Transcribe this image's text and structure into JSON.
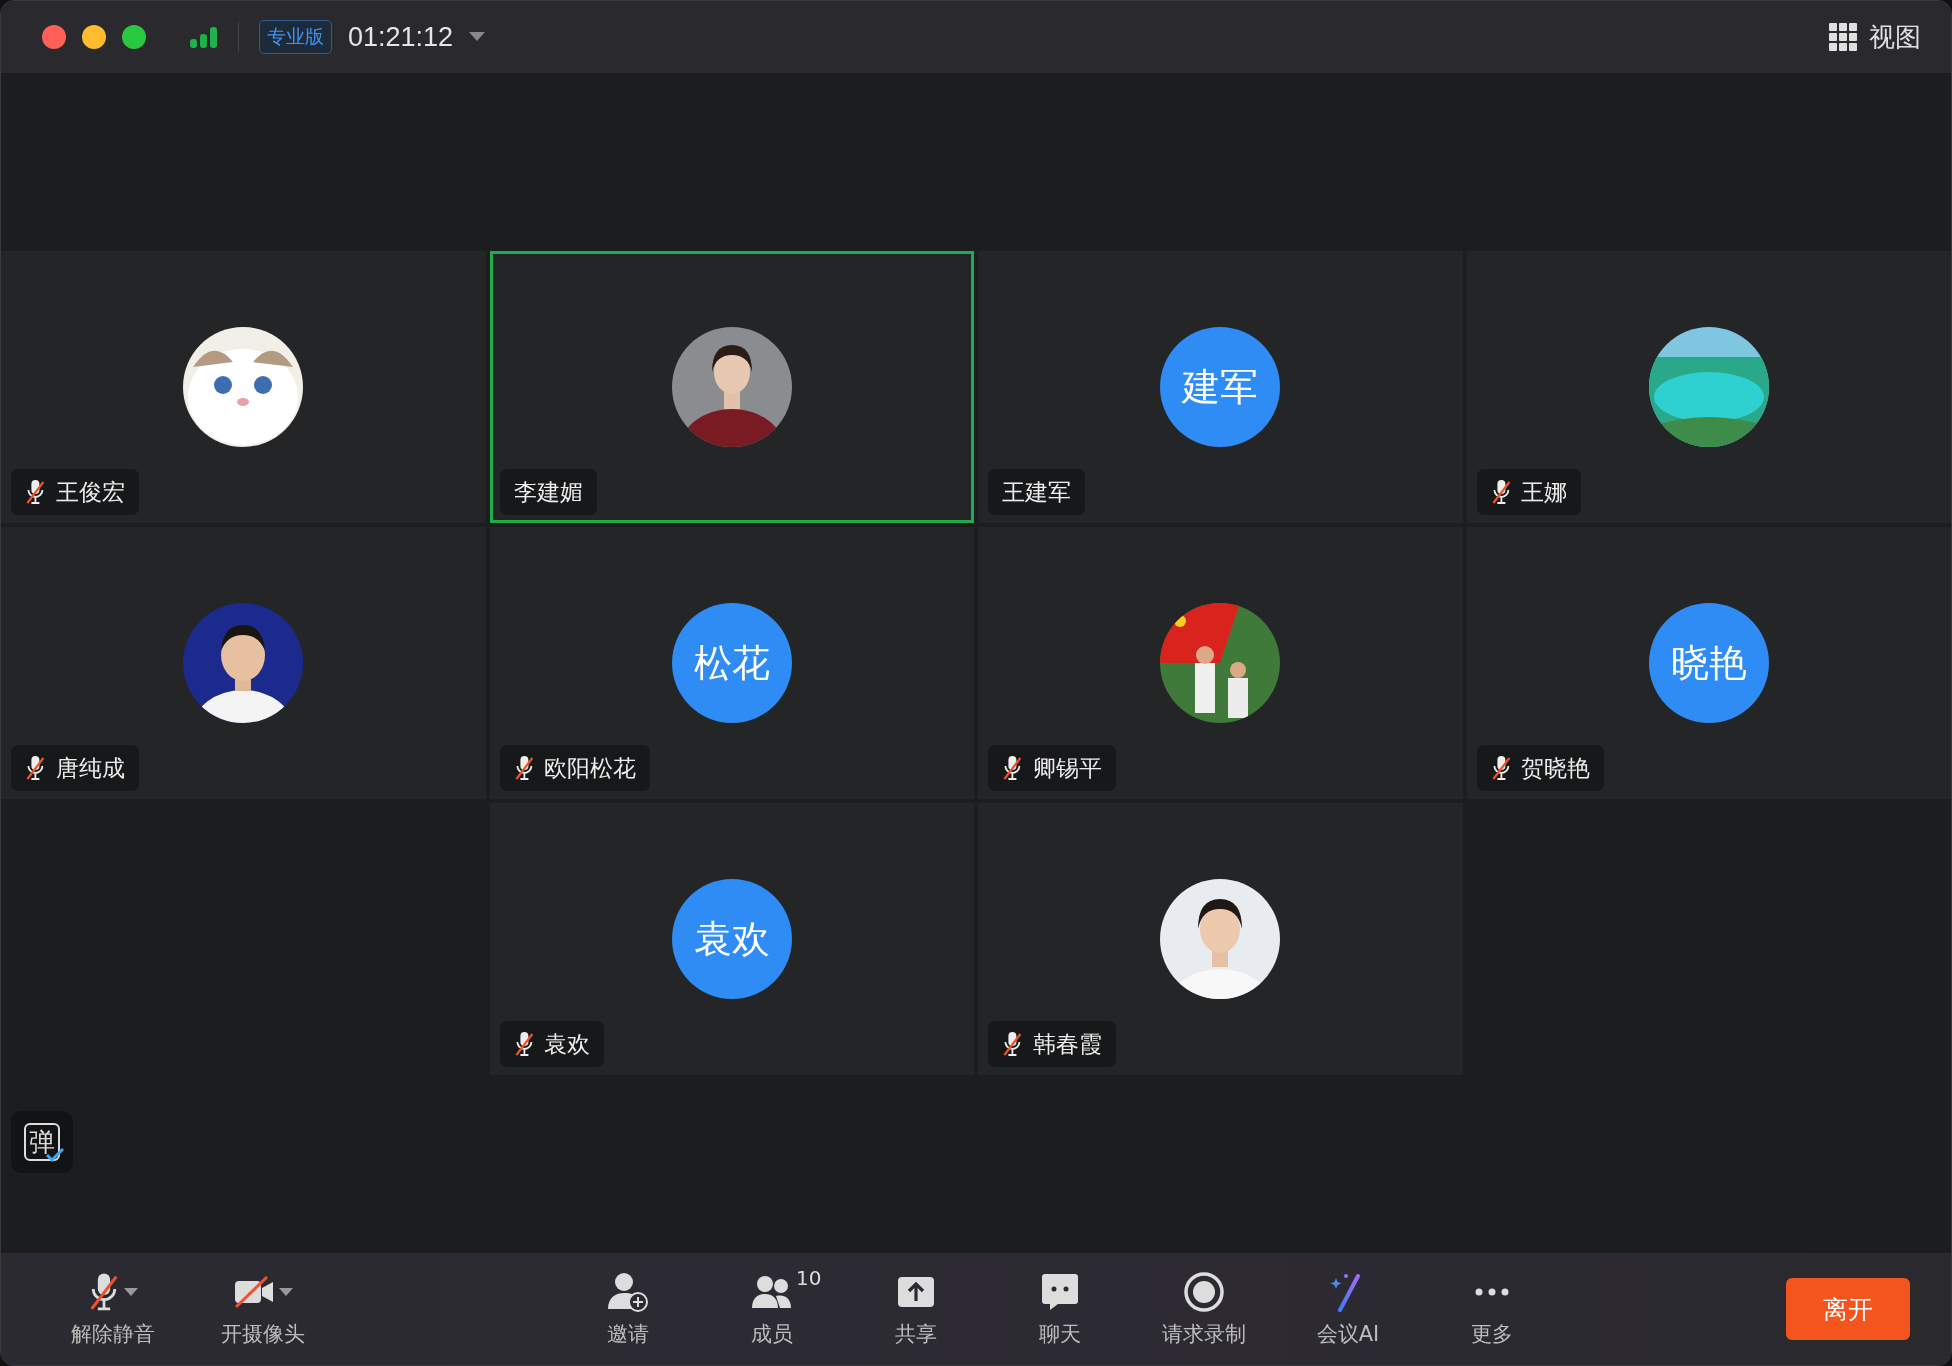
{
  "window": {
    "edition_badge": "专业版",
    "timer": "01:21:12",
    "view_button": "视图"
  },
  "tiles": [
    {
      "name": "王俊宏",
      "muted": true,
      "speaking": false
    },
    {
      "name": "李建媚",
      "muted": false,
      "speaking": true
    },
    {
      "name": "王建军",
      "avatar": {
        "kind": "initials",
        "text": "建军"
      },
      "muted": false,
      "speaking": false
    },
    {
      "name": "王娜",
      "muted": true,
      "speaking": false
    },
    {
      "name": "唐纯成",
      "muted": true,
      "speaking": false
    },
    {
      "name": "欧阳松花",
      "avatar": {
        "kind": "initials",
        "text": "松花"
      },
      "muted": true,
      "speaking": false
    },
    {
      "name": "卿锡平",
      "muted": true,
      "speaking": false
    },
    {
      "name": "贺晓艳",
      "avatar": {
        "kind": "initials",
        "text": "晓艳"
      },
      "muted": true,
      "speaking": false
    },
    {
      "kind": "empty"
    },
    {
      "name": "袁欢",
      "avatar": {
        "kind": "initials",
        "text": "袁欢"
      },
      "muted": true,
      "speaking": false
    },
    {
      "name": "韩春霞",
      "muted": true,
      "speaking": false
    }
  ],
  "danmaku_button": {
    "label": "弹"
  },
  "toolbar": {
    "left": [
      {
        "kind": "mic",
        "label": "解除静音"
      },
      {
        "kind": "camera",
        "label": "开摄像头"
      }
    ],
    "center": [
      {
        "kind": "invite",
        "label": "邀请"
      },
      {
        "kind": "members",
        "label": "成员",
        "count": "10"
      },
      {
        "kind": "share",
        "label": "共享"
      },
      {
        "kind": "chat",
        "label": "聊天"
      },
      {
        "kind": "record",
        "label": "请求录制"
      },
      {
        "kind": "ai",
        "label": "会议AI"
      },
      {
        "kind": "more",
        "label": "更多"
      }
    ],
    "leave_button": "离开"
  }
}
